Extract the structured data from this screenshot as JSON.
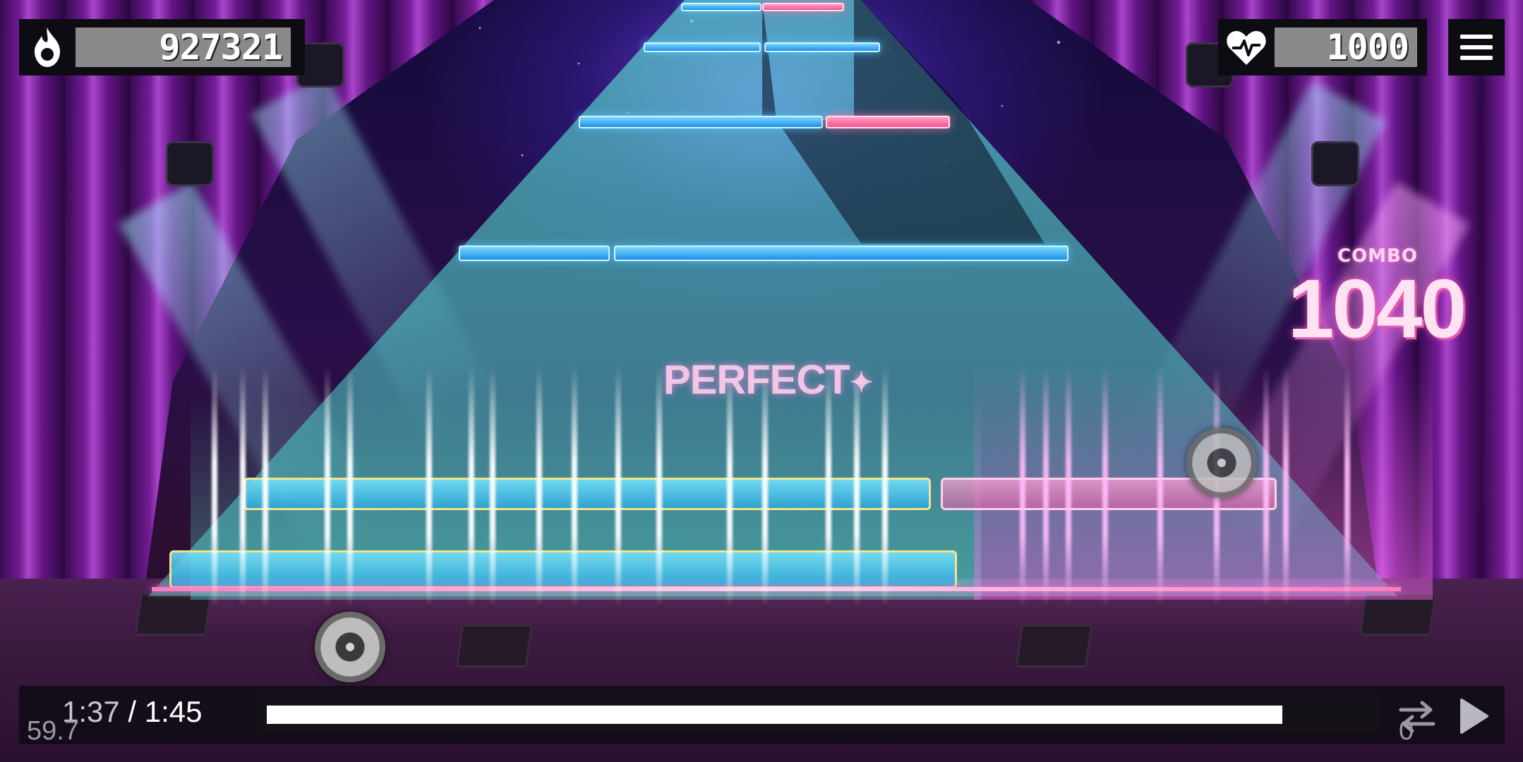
{
  "hud": {
    "score": "927321",
    "score_icon": "flame-icon",
    "hp": "1000",
    "hp_icon": "heart-pulse-icon",
    "menu_icon": "hamburger-menu-icon"
  },
  "combo": {
    "label": "COMBO",
    "value": "1040"
  },
  "judgement": {
    "text": "PERFECT",
    "star": "✦"
  },
  "playback": {
    "current_time": "1:37",
    "separator": " / ",
    "total_time": "1:45",
    "progress_fraction": 0.92,
    "fps": "59.7",
    "counter": "0",
    "swap_icon": "swap-arrows-icon",
    "play_icon": "play-icon"
  },
  "colors": {
    "note_blue": "#1e8fe6",
    "note_pink": "#ff5090",
    "track_teal": "#5adcd2",
    "hud_bg": "#0c0c12",
    "hud_value_bg": "#8a8a8a",
    "combo_pink": "#ffe3f2"
  }
}
